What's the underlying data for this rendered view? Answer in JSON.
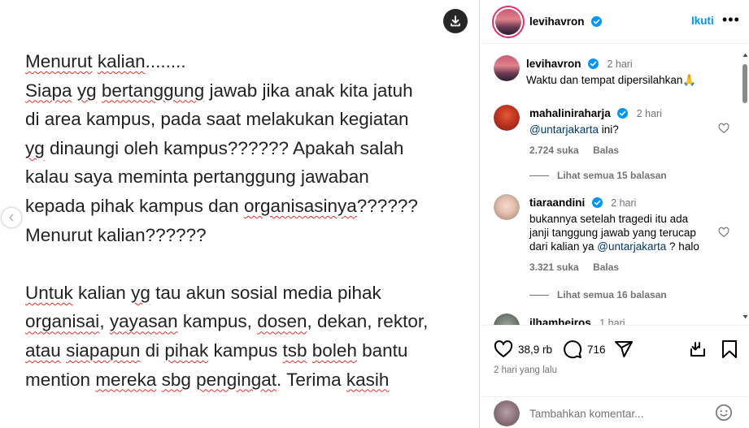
{
  "post": {
    "text_lines": [
      [
        {
          "t": "Menurut",
          "s": true
        },
        {
          "t": " "
        },
        {
          "t": "kalian",
          "s": true
        },
        {
          "t": "........"
        }
      ],
      [
        {
          "t": "Siapa",
          "s": true
        },
        {
          "t": " "
        },
        {
          "t": "yg",
          "s": true
        },
        {
          "t": " "
        },
        {
          "t": "bertanggung",
          "s": true
        },
        {
          "t": " jawab jika anak kita jatuh"
        }
      ],
      [
        {
          "t": "di area kampus, pada saat melakukan kegiatan"
        }
      ],
      [
        {
          "t": "yg",
          "s": true
        },
        {
          "t": " dinaungi oleh kampus?????? Apakah salah"
        }
      ],
      [
        {
          "t": "kalau saya meminta pertanggung jawaban"
        }
      ],
      [
        {
          "t": "kepada pihak kampus dan "
        },
        {
          "t": "organisasinya",
          "s": true
        },
        {
          "t": "??????"
        }
      ],
      [
        {
          "t": "Menurut kalian??????"
        }
      ],
      [],
      [
        {
          "t": "Untuk",
          "s": true
        },
        {
          "t": " kalian "
        },
        {
          "t": "yg",
          "s": true
        },
        {
          "t": " tau akun sosial media pihak"
        }
      ],
      [
        {
          "t": "organisai",
          "s": true
        },
        {
          "t": ", "
        },
        {
          "t": "yayasan",
          "s": true
        },
        {
          "t": " kampus, "
        },
        {
          "t": "dosen",
          "s": true
        },
        {
          "t": ", dekan, rektor,"
        }
      ],
      [
        {
          "t": "atau",
          "s": true
        },
        {
          "t": " "
        },
        {
          "t": "siapapun",
          "s": true
        },
        {
          "t": " di "
        },
        {
          "t": "pihak",
          "s": true
        },
        {
          "t": " kampus "
        },
        {
          "t": "tsb",
          "s": true
        },
        {
          "t": " "
        },
        {
          "t": "boleh",
          "s": true
        },
        {
          "t": " bantu"
        }
      ],
      [
        {
          "t": "mention "
        },
        {
          "t": "mereka",
          "s": true
        },
        {
          "t": " "
        },
        {
          "t": "sbg",
          "s": true
        },
        {
          "t": " "
        },
        {
          "t": "pengingat",
          "s": true
        },
        {
          "t": ". Terima "
        },
        {
          "t": "kasih",
          "s": true
        }
      ]
    ]
  },
  "header": {
    "username": "levihavron",
    "follow_label": "Ikuti",
    "more_label": "•••"
  },
  "caption": {
    "username": "levihavron",
    "time": "2 hari",
    "text": "Waktu dan tempat dipersilahkan🙏"
  },
  "comments": [
    {
      "username": "mahalini raharja",
      "handle": "mahaliniraharja",
      "time": "2 hari",
      "mention": "@untarjakarta",
      "text_after": " ini?",
      "likes": "2.724 suka",
      "reply_label": "Balas",
      "view_replies": "Lihat semua 15 balasan"
    },
    {
      "handle": "tiaraandini",
      "time": "2 hari",
      "text_lines": [
        "bukannya setelah tragedi itu ada",
        "janji tanggung jawab yang terucap"
      ],
      "text_prefix": "dari kalian ya ",
      "mention": "@untarjakarta",
      "text_after": " ? halo",
      "likes": "3.321 suka",
      "reply_label": "Balas",
      "view_replies": "Lihat semua 16 balasan"
    },
    {
      "handle": "ilhamheiros",
      "time": "1 hari"
    }
  ],
  "actions": {
    "likes": "38,9 rb",
    "comments": "716",
    "date": "2 hari yang lalu"
  },
  "composer": {
    "placeholder": "Tambahkan komentar..."
  },
  "colors": {
    "link_blue": "#0095f6",
    "mention": "#00376b",
    "muted": "#737373",
    "verified": "#0095f6"
  },
  "icons": [
    "download-icon",
    "chevron-left-icon",
    "verified-icon",
    "heart-icon",
    "comment-icon",
    "share-icon",
    "save-icon",
    "emoji-icon"
  ]
}
